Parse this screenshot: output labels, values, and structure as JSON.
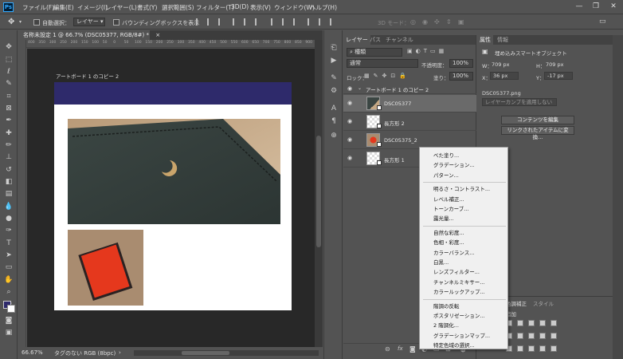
{
  "menubar": {
    "app_logo": "Ps",
    "items": [
      "ファイル(F)",
      "編集(E)",
      "イメージ(I)",
      "レイヤー(L)",
      "書式(Y)",
      "選択範囲(S)",
      "フィルター(T)",
      "3D(D)",
      "表示(V)",
      "ウィンドウ(W)",
      "ヘルプ(H)"
    ],
    "window_buttons": [
      "—",
      "❐",
      "✕"
    ]
  },
  "options": {
    "auto_select_label": "自動選択：",
    "auto_select_value": "レイヤー",
    "bounding_box_label": "バウンディングボックスを表示",
    "mode_3d_label": "3D モード："
  },
  "document": {
    "tab_title": "名称未設定 1 @ 66.7% (DSC05377, RGB/8#) *",
    "tab_close": "×",
    "artboard_label": "アートボード 1 のコピー 2",
    "ruler_ticks": [
      "400",
      "350",
      "300",
      "250",
      "200",
      "150",
      "100",
      "50",
      "0",
      "50",
      "100",
      "150",
      "200",
      "250",
      "300",
      "350",
      "400",
      "450",
      "500",
      "550",
      "600",
      "650",
      "700",
      "750",
      "800",
      "850",
      "900"
    ],
    "zoom": "66.67%",
    "color_profile": "タグのない RGB (8bpc)",
    "status_arrow": "›"
  },
  "tools": {
    "icons": [
      "move",
      "marquee",
      "lasso",
      "quick-select",
      "crop",
      "frame",
      "eyedropper",
      "healing",
      "brush",
      "stamp",
      "history-brush",
      "eraser",
      "gradient",
      "blur",
      "dodge",
      "pen",
      "type",
      "path-select",
      "shape",
      "hand",
      "zoom",
      "more"
    ],
    "fg_color": "#2e2a6b",
    "bg_color": "#ffffff"
  },
  "layers_panel": {
    "tabs": [
      "レイヤー",
      "パス",
      "チャンネル"
    ],
    "filter_kind": "種類",
    "blend_mode": "通常",
    "opacity_label": "不透明度：",
    "opacity_value": "100%",
    "lock_label": "ロック：",
    "fill_label": "塗り：",
    "fill_value": "100%",
    "artboard_name": "アートボード 1 のコピー 2",
    "layers": [
      {
        "name": "DSC05377",
        "selected": true
      },
      {
        "name": "長方形 2",
        "selected": false
      },
      {
        "name": "DSC05375_2",
        "selected": false
      },
      {
        "name": "長方形 1",
        "selected": false
      }
    ],
    "footer_icons": [
      "link-icon",
      "fx-icon",
      "mask-icon",
      "adjustment-icon",
      "group-icon",
      "new-layer-icon",
      "trash-icon"
    ]
  },
  "properties_panel": {
    "tabs": [
      "属性",
      "情報"
    ],
    "object_type": "埋め込みスマートオブジェクト",
    "w_label": "W：",
    "w_value": "709 px",
    "h_label": "H：",
    "h_value": "709 px",
    "x_label": "X：",
    "x_value": "36 px",
    "y_label": "Y：",
    "y_value": "-17 px",
    "file_name": "DSC05377.png",
    "layer_comp": "レイヤーカンプを適用しない",
    "edit_contents_button": "コンテンツを編集",
    "convert_linked_button": "リンクされたアイテムに変換..."
  },
  "adjustments_panel": {
    "tabs": [
      "色調補正",
      "スタイル"
    ],
    "add_label": "追加"
  },
  "context_menu": {
    "groups": [
      [
        "べた塗り...",
        "グラデーション...",
        "パターン..."
      ],
      [
        "明るさ・コントラスト...",
        "レベル補正...",
        "トーンカーブ...",
        "露光量..."
      ],
      [
        "自然な彩度...",
        "色相・彩度...",
        "カラーバランス...",
        "白黒...",
        "レンズフィルター...",
        "チャンネルミキサー...",
        "カラールックアップ..."
      ],
      [
        "階調の反転",
        "ポスタリゼーション...",
        "2 階調化...",
        "グラデーションマップ...",
        "特定色域の選択..."
      ]
    ]
  }
}
